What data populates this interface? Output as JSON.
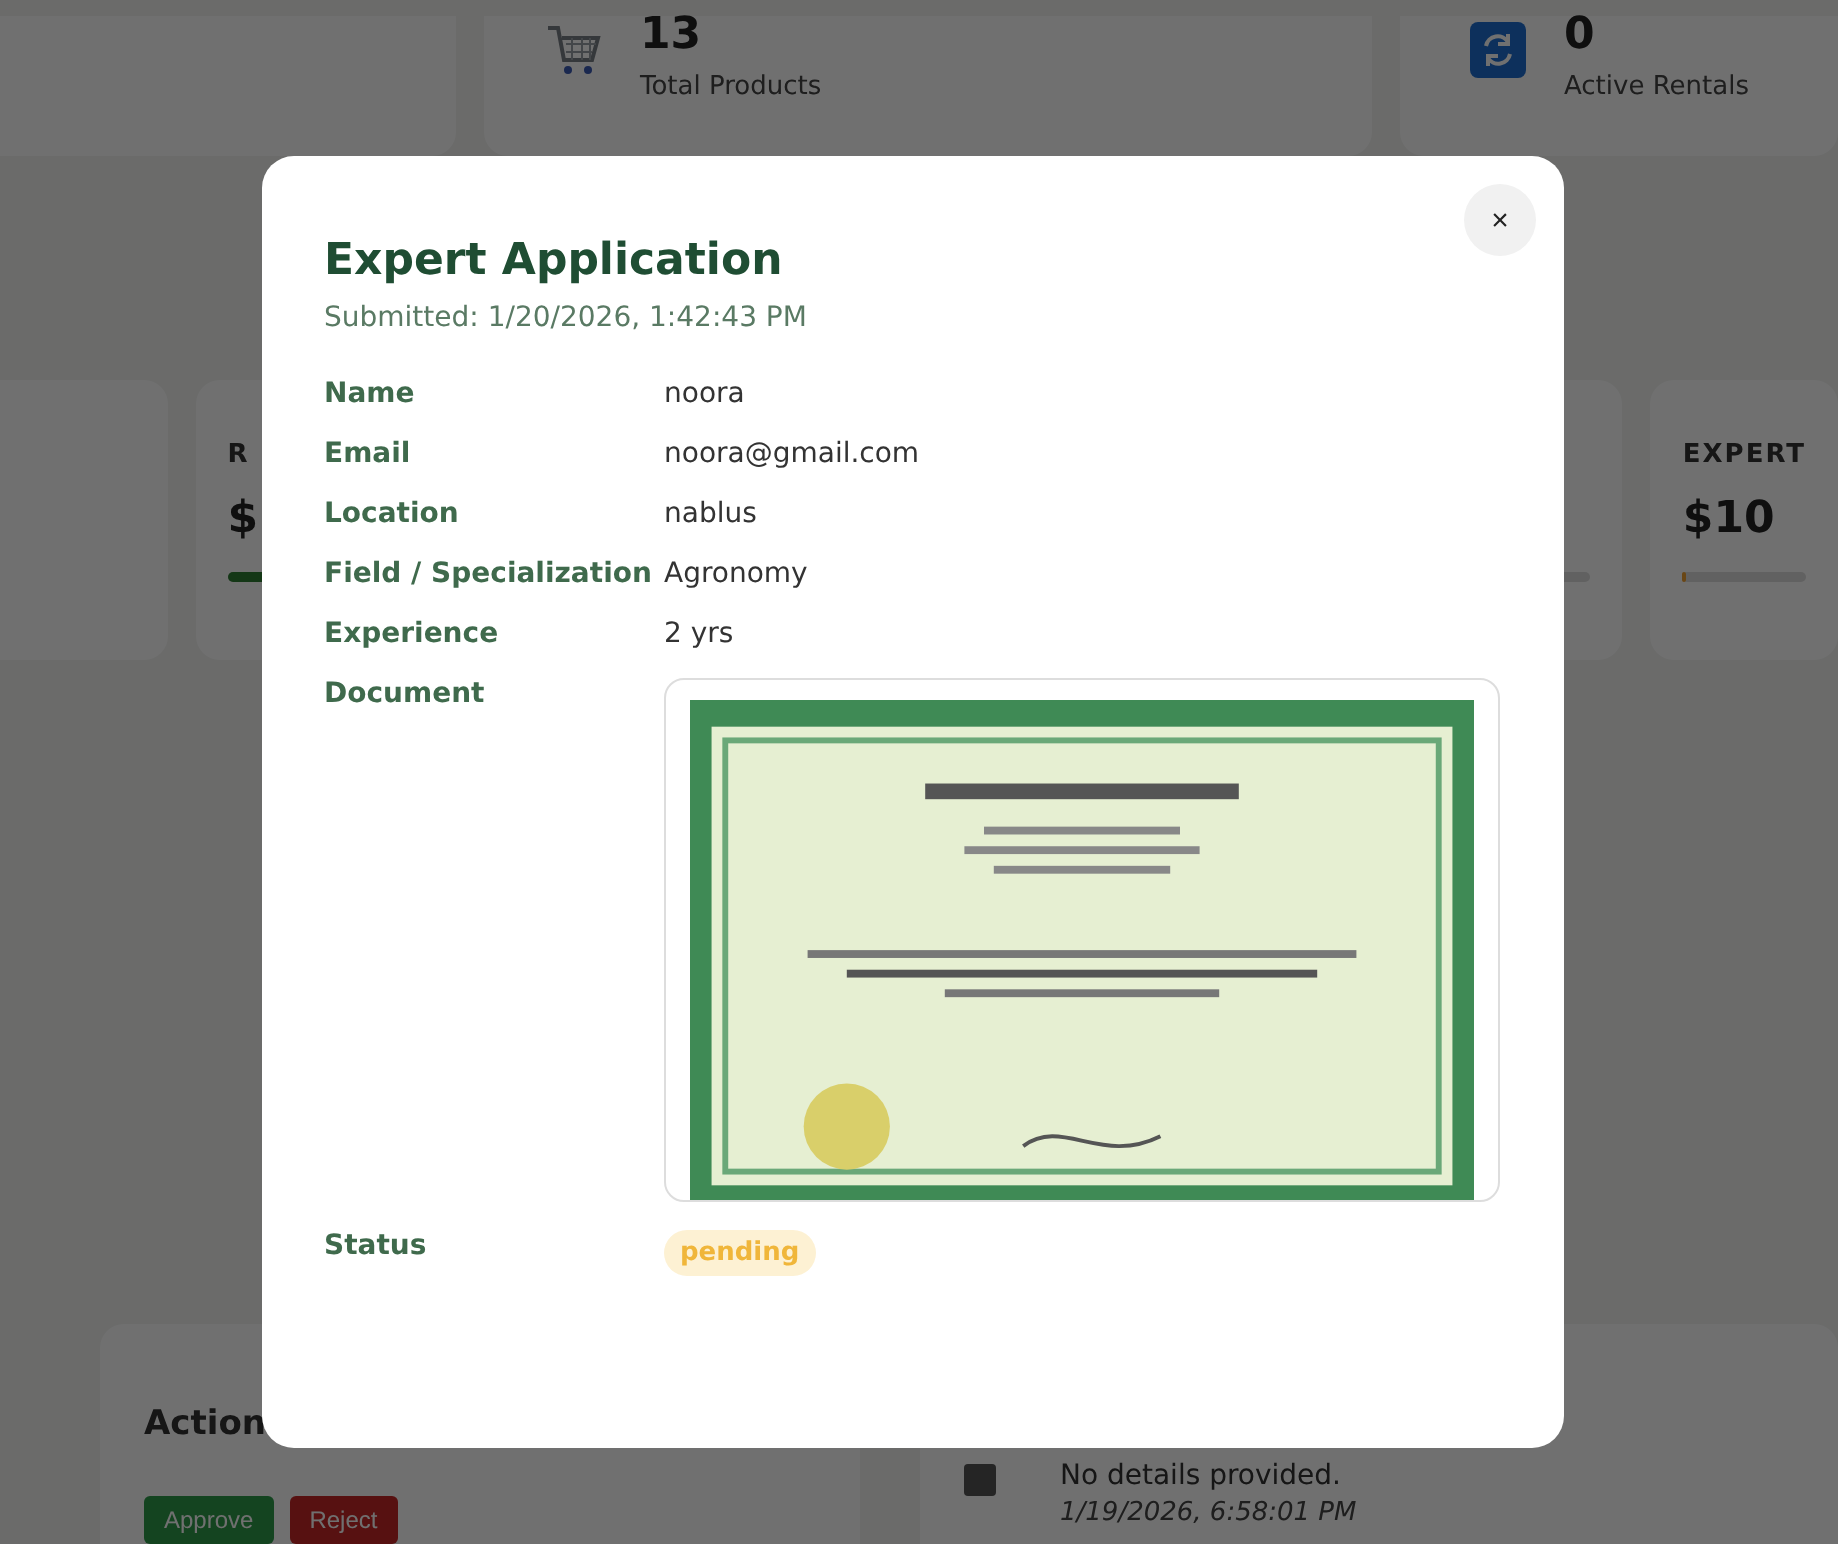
{
  "background": {
    "stats": [
      {
        "value": "13",
        "label": "Total Products"
      },
      {
        "value": "0",
        "label": "Active Rentals"
      }
    ],
    "revenue_cards": [
      {
        "label": "R",
        "value": "$",
        "level": 0.2
      },
      {
        "label": "EXPERT",
        "value": "$10",
        "level": 0.03
      }
    ],
    "actions": {
      "title": "Action",
      "buttons": [
        {
          "label": "Approve",
          "kind": "approve"
        },
        {
          "label": "Reject",
          "kind": "reject"
        }
      ]
    },
    "activity": {
      "text": "No details provided.",
      "time": "1/19/2026, 6:58:01 PM"
    }
  },
  "modal": {
    "close": "×",
    "title": "Expert Application",
    "submitted": "Submitted: 1/20/2026, 1:42:43 PM",
    "fields": [
      {
        "label": "Name",
        "value": "noora"
      },
      {
        "label": "Email",
        "value": "noora@gmail.com"
      },
      {
        "label": "Location",
        "value": "nablus"
      },
      {
        "label": "Field / Specialization",
        "value": "Agronomy"
      },
      {
        "label": "Experience",
        "value": "2 yrs"
      }
    ],
    "document_label": "Document",
    "status_label": "Status",
    "status": "pending"
  }
}
